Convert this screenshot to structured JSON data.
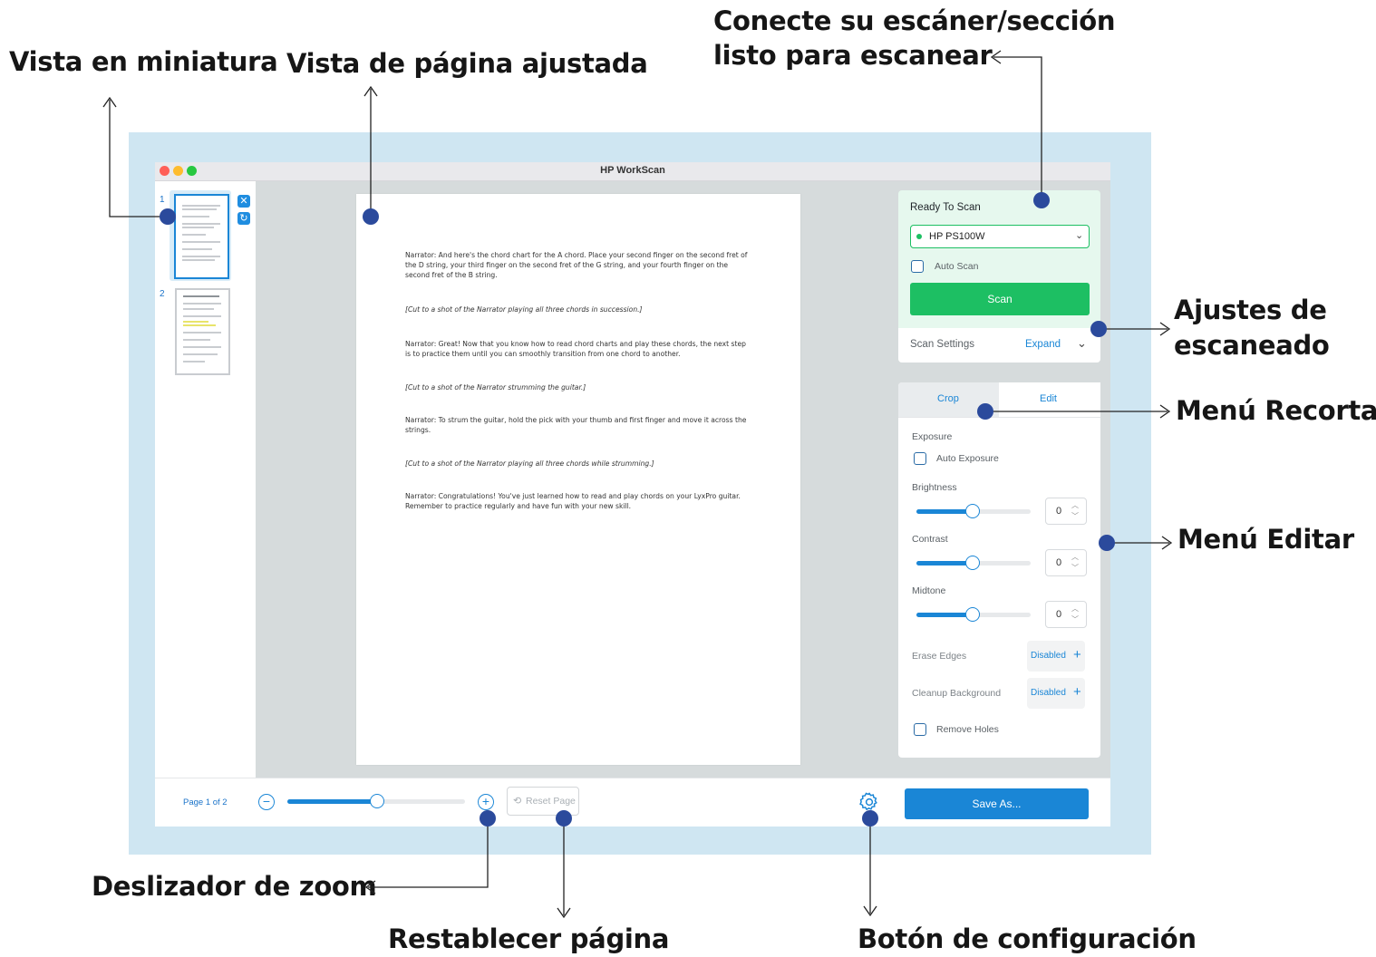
{
  "callouts": {
    "thumbnail_view": "Vista en miniatura",
    "fit_page_view": "Vista de página ajustada",
    "connect_scanner_1": "Conecte su escáner/sección",
    "connect_scanner_2": "listo para escanear",
    "scan_settings_1": "Ajustes de",
    "scan_settings_2": "escaneado",
    "crop_menu": "Menú Recortar",
    "edit_menu": "Menú Editar",
    "zoom_slider": "Deslizador de zoom",
    "reset_page": "Restablecer página",
    "settings_button": "Botón de configuración"
  },
  "window": {
    "title": "HP WorkScan"
  },
  "thumbnails": {
    "items": [
      {
        "number": "1",
        "selected": true
      },
      {
        "number": "2",
        "selected": false
      }
    ]
  },
  "document": {
    "paragraphs": [
      {
        "text": "Narrator: And here's the chord chart for the A chord. Place your second finger on the second fret of the D string, your third finger on the second fret of the G string, and your fourth finger on the second fret of the B string.",
        "italic": false
      },
      {
        "text": "[Cut to a shot of the Narrator playing all three chords in succession.]",
        "italic": true
      },
      {
        "text": "Narrator: Great! Now that you know how to read chord charts and play these chords, the next step is to practice them until you can smoothly transition from one chord to another.",
        "italic": false
      },
      {
        "text": "[Cut to a shot of the Narrator strumming the guitar.]",
        "italic": true
      },
      {
        "text": "Narrator: To strum the guitar, hold the pick with your thumb and first finger and move it across the strings.",
        "italic": false
      },
      {
        "text": "[Cut to a shot of the Narrator playing all three chords while strumming.]",
        "italic": true
      },
      {
        "text": "Narrator: Congratulations! You've just learned how to read and play chords on your LyxPro guitar. Remember to practice regularly and have fun with your new skill.",
        "italic": false
      }
    ]
  },
  "scan_panel": {
    "status": "Ready To Scan",
    "scanner": "HP PS100W",
    "auto_scan": "Auto Scan",
    "scan_button": "Scan",
    "scan_settings": "Scan Settings",
    "expand": "Expand"
  },
  "edit_panel": {
    "tabs": [
      "Crop",
      "Edit"
    ],
    "active_tab": "Edit",
    "exposure": "Exposure",
    "auto_exposure": "Auto Exposure",
    "sliders": [
      {
        "label": "Brightness",
        "value": "0"
      },
      {
        "label": "Contrast",
        "value": "0"
      },
      {
        "label": "Midtone",
        "value": "0"
      }
    ],
    "erase_edges": {
      "label": "Erase Edges",
      "value": "Disabled"
    },
    "cleanup_background": {
      "label": "Cleanup Background",
      "value": "Disabled"
    },
    "remove_holes": "Remove Holes"
  },
  "bottom_bar": {
    "page_indicator": "Page 1 of 2",
    "zoom_level": 0.5,
    "reset_page": "Reset Page",
    "save_as": "Save As..."
  },
  "colors": {
    "accent_green": "#1dbf63",
    "accent_blue": "#1a86d6",
    "marker": "#2b4a9c",
    "frame": "#cfe6f2",
    "scan_card": "#e6f8ee"
  }
}
